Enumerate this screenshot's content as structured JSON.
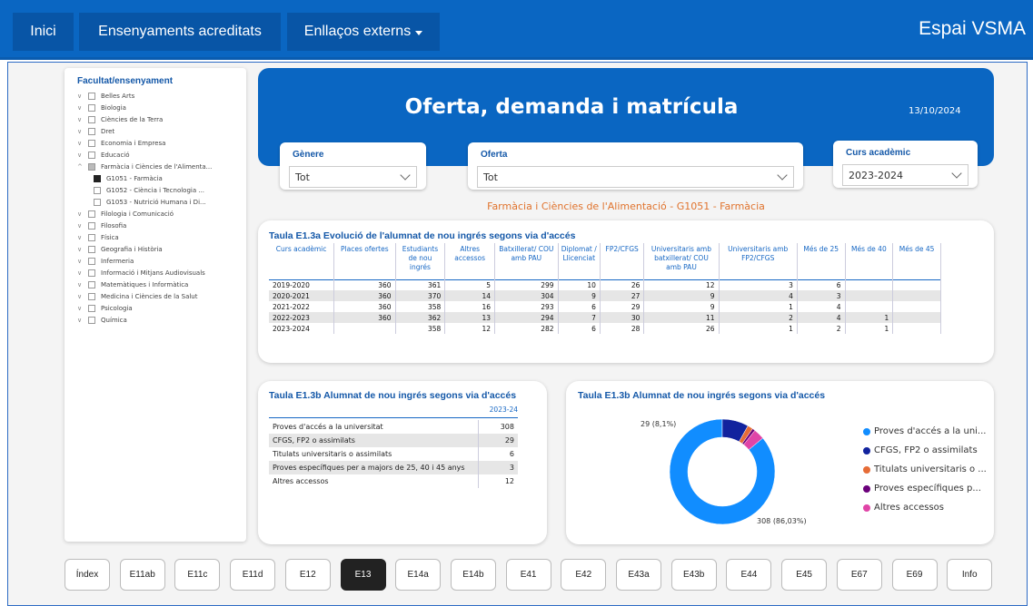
{
  "nav": {
    "home": "Inici",
    "accredited": "Ensenyaments acreditats",
    "links": "Enllaços externs",
    "brand": "Espai VSMA"
  },
  "slicer": {
    "title": "Facultat/ensenyament",
    "items": [
      {
        "label": "Belles Arts",
        "state": "collapsed"
      },
      {
        "label": "Biologia",
        "state": "collapsed"
      },
      {
        "label": "Ciències de la Terra",
        "state": "collapsed"
      },
      {
        "label": "Dret",
        "state": "collapsed"
      },
      {
        "label": "Economia i Empresa",
        "state": "collapsed"
      },
      {
        "label": "Educació",
        "state": "collapsed"
      },
      {
        "label": "Farmàcia i Ciències de l'Alimenta...",
        "state": "expanded"
      },
      {
        "label": "G1051 - Farmàcia",
        "state": "child-selected"
      },
      {
        "label": "G1052 - Ciència i Tecnologia ...",
        "state": "child"
      },
      {
        "label": "G1053 - Nutrició Humana i Di...",
        "state": "child"
      },
      {
        "label": "Filologia i Comunicació",
        "state": "collapsed"
      },
      {
        "label": "Filosofia",
        "state": "collapsed"
      },
      {
        "label": "Física",
        "state": "collapsed"
      },
      {
        "label": "Geografia i Història",
        "state": "collapsed"
      },
      {
        "label": "Infermeria",
        "state": "collapsed"
      },
      {
        "label": "Informació i Mitjans Audiovisuals",
        "state": "collapsed"
      },
      {
        "label": "Matemàtiques i Informàtica",
        "state": "collapsed"
      },
      {
        "label": "Medicina i Ciències de la Salut",
        "state": "collapsed"
      },
      {
        "label": "Psicologia",
        "state": "collapsed"
      },
      {
        "label": "Química",
        "state": "collapsed"
      }
    ]
  },
  "header": {
    "title": "Oferta, demanda i matrícula",
    "date": "13/10/2024"
  },
  "filters": {
    "genere": {
      "label": "Gènere",
      "value": "Tot"
    },
    "oferta": {
      "label": "Oferta",
      "value": "Tot"
    },
    "curs": {
      "label": "Curs acadèmic",
      "value": "2023-2024"
    }
  },
  "subtitle": "Farmàcia i Ciències de l'Alimentació - G1051 - Farmàcia",
  "table_a": {
    "title": "Taula E1.3a Evolució de l'alumnat de nou ingrés segons via d'accés",
    "headers": [
      "Curs acadèmic",
      "Places ofertes",
      "Estudiants de nou ingrés",
      "Altres accessos",
      "Batxillerat/ COU amb PAU",
      "Diplomat / Llicenciat",
      "FP2/CFGS",
      "Universitaris amb batxillerat/ COU amb PAU",
      "Universitaris amb FP2/CFGS",
      "Més de 25",
      "Més de 40",
      "Més de 45"
    ],
    "rows": [
      [
        "2019-2020",
        "360",
        "361",
        "5",
        "299",
        "10",
        "26",
        "12",
        "3",
        "6",
        "",
        ""
      ],
      [
        "2020-2021",
        "360",
        "370",
        "14",
        "304",
        "9",
        "27",
        "9",
        "4",
        "3",
        "",
        ""
      ],
      [
        "2021-2022",
        "360",
        "358",
        "16",
        "293",
        "6",
        "29",
        "9",
        "1",
        "4",
        "",
        ""
      ],
      [
        "2022-2023",
        "360",
        "362",
        "13",
        "294",
        "7",
        "30",
        "11",
        "2",
        "4",
        "1",
        ""
      ],
      [
        "2023-2024",
        "",
        "358",
        "12",
        "282",
        "6",
        "28",
        "26",
        "1",
        "2",
        "1",
        ""
      ]
    ]
  },
  "table_b": {
    "title": "Taula E1.3b Alumnat de nou ingrés segons via d'accés",
    "col_header": "2023-24",
    "rows": [
      [
        "Proves d'accés a la universitat",
        "308"
      ],
      [
        "CFGS, FP2 o assimilats",
        "29"
      ],
      [
        "Titulats universitaris o assimilats",
        "6"
      ],
      [
        "Proves específiques per a majors de 25, 40 i 45 anys",
        "3"
      ],
      [
        "Altres accessos",
        "12"
      ]
    ]
  },
  "chart_data": {
    "type": "pie",
    "title": "Taula E1.3b Alumnat de nou ingrés segons via d'accés",
    "categories": [
      "Proves d'accés a la uni...",
      "CFGS, FP2 o assimilats",
      "Titulats universitaris o ...",
      "Proves específiques p...",
      "Altres accessos"
    ],
    "values": [
      308,
      29,
      6,
      3,
      12
    ],
    "colors": [
      "#118dff",
      "#12239e",
      "#e66c37",
      "#6b007b",
      "#e044a7"
    ],
    "data_labels": [
      "308 (86,03%)",
      "29 (8,1%)"
    ],
    "legend": "right"
  },
  "pages": [
    "Índex",
    "E11ab",
    "E11c",
    "E11d",
    "E12",
    "E13",
    "E14a",
    "E14b",
    "E41",
    "E42",
    "E43a",
    "E43b",
    "E44",
    "E45",
    "E67",
    "E69",
    "Info"
  ],
  "active_page": "E13"
}
